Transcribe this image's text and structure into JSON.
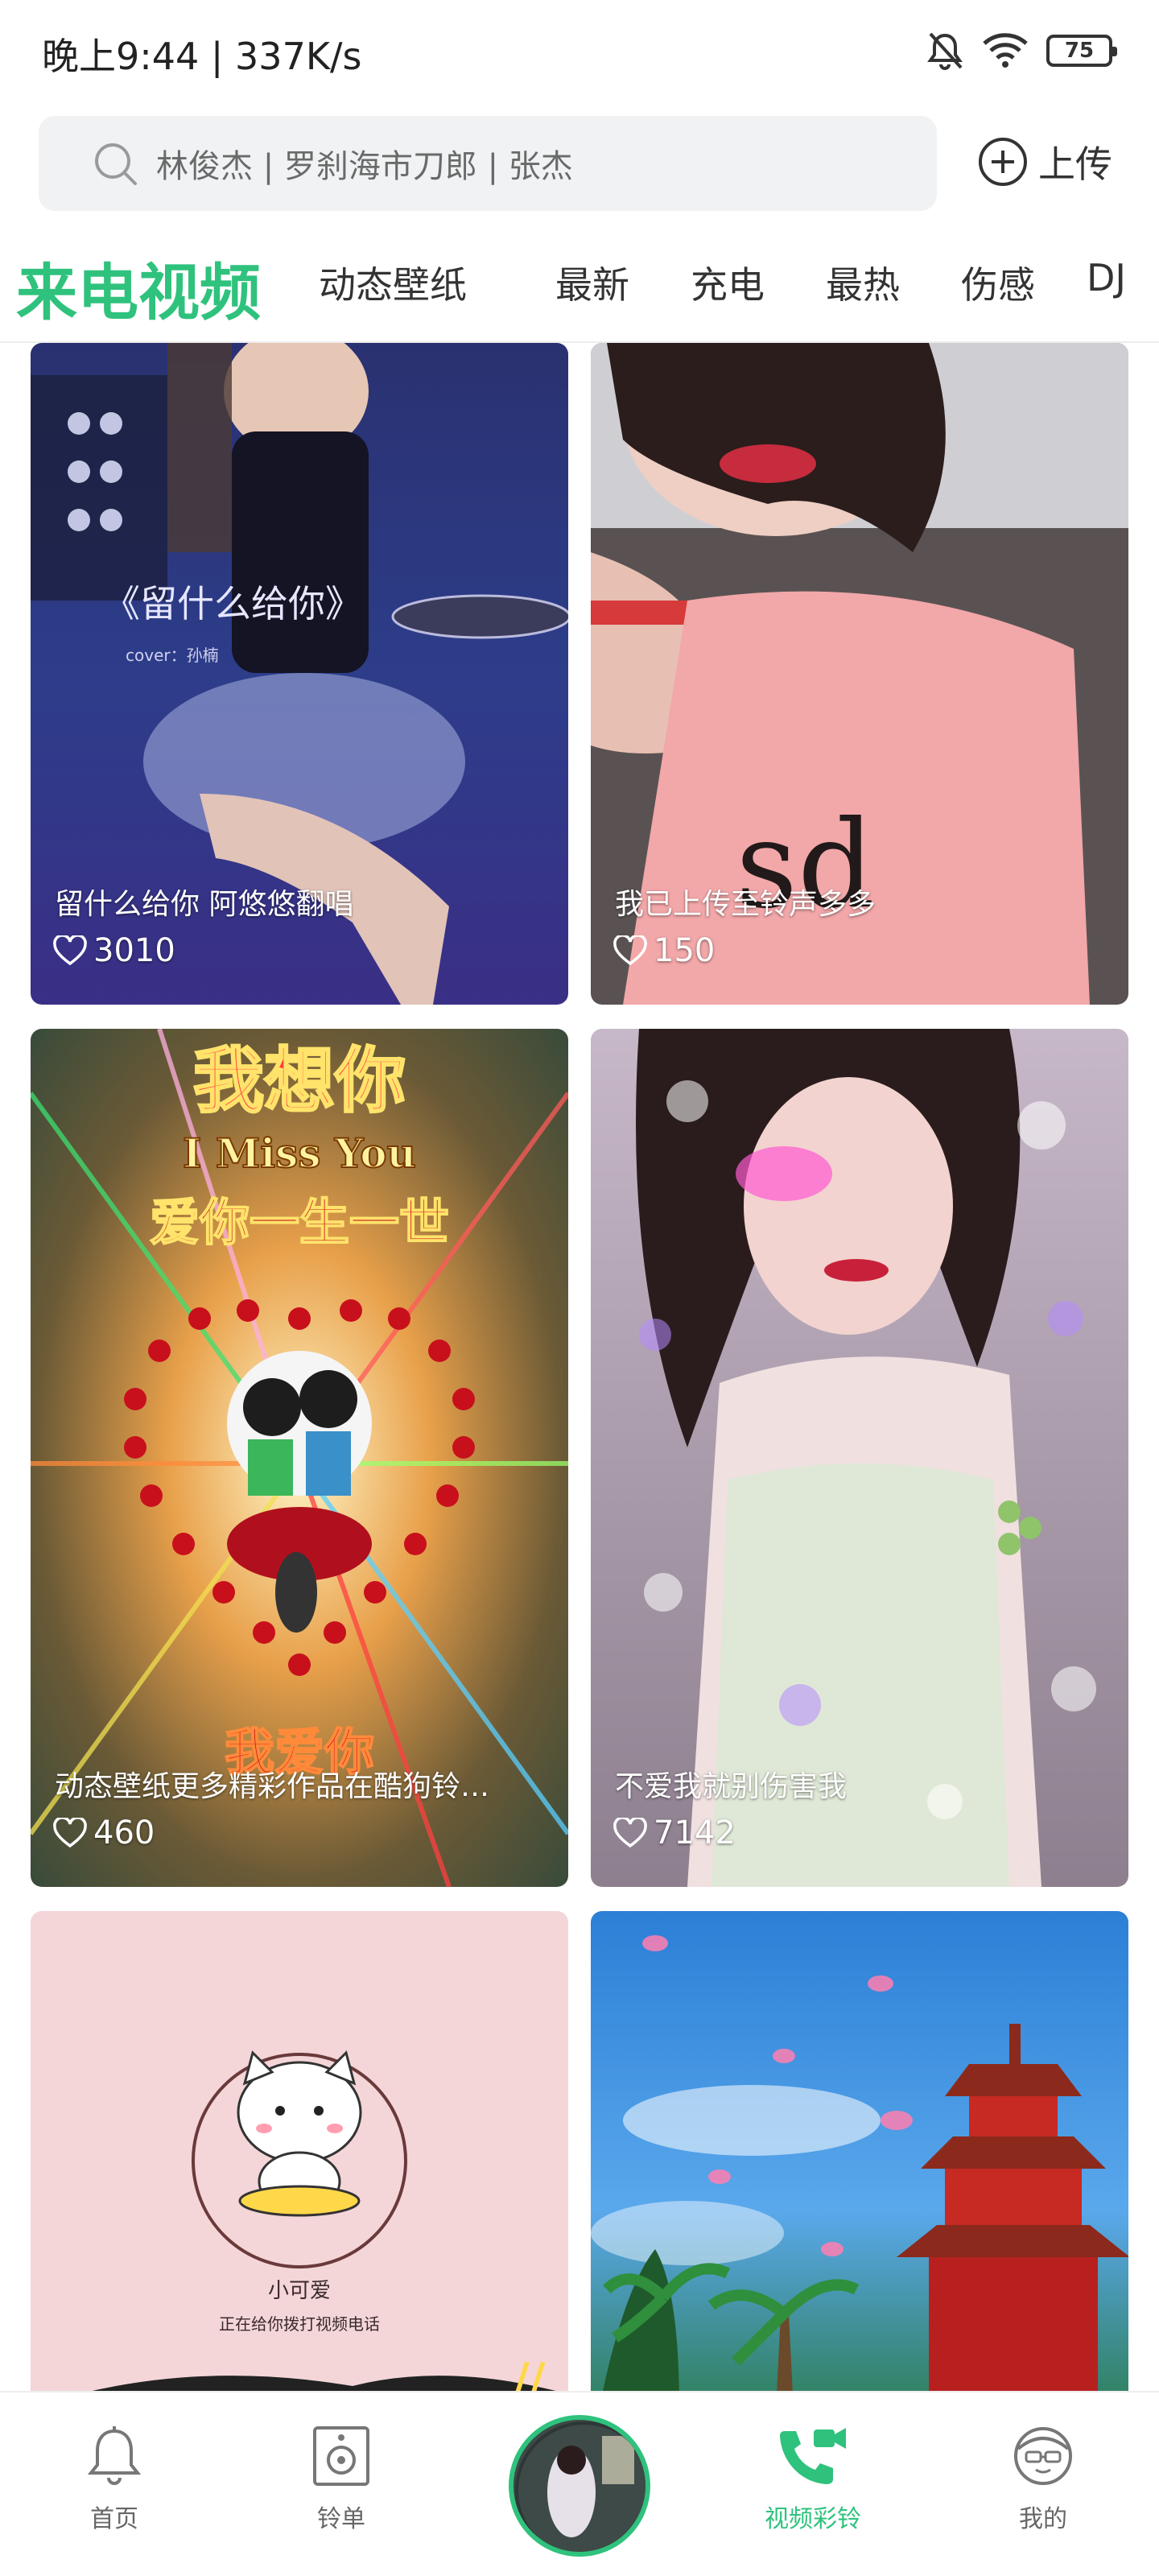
{
  "status_bar": {
    "time_speed": "晚上9:44 | 337K/s",
    "battery": "75"
  },
  "search": {
    "placeholder": "林俊杰 | 罗刹海市刀郎 | 张杰"
  },
  "upload_label": "上传",
  "tabs": [
    {
      "label": "来电视频",
      "active": true
    },
    {
      "label": "动态壁纸"
    },
    {
      "label": "最新"
    },
    {
      "label": "充电"
    },
    {
      "label": "最热"
    },
    {
      "label": "伤感"
    },
    {
      "label": "DJ"
    }
  ],
  "cards": [
    {
      "caption": "留什么给你  阿悠悠翻唱",
      "likes": "3010",
      "art_text": "《留什么给你》",
      "art_sub": "cover：孙楠"
    },
    {
      "caption": "我已上传至铃声多多",
      "likes": "150"
    },
    {
      "caption": "动态壁纸更多精彩作品在酷狗铃…",
      "likes": "460",
      "art_title": "我想你",
      "art_en": "I Miss You",
      "art_line": "爱你一生一世",
      "art_bottom": "我爱你"
    },
    {
      "caption": "不爱我就别伤害我",
      "likes": "7142"
    },
    {
      "art_title": "小可爱",
      "art_sub": "正在给你拨打视频电话"
    },
    {}
  ],
  "bottom_nav": [
    {
      "label": "首页",
      "icon": "bell-icon"
    },
    {
      "label": "铃单",
      "icon": "speaker-icon"
    },
    {
      "label": "视频彩铃",
      "icon": "video-phone-icon",
      "active": true
    },
    {
      "label": "我的",
      "icon": "profile-face-icon"
    }
  ],
  "colors": {
    "accent": "#2fc27d"
  }
}
